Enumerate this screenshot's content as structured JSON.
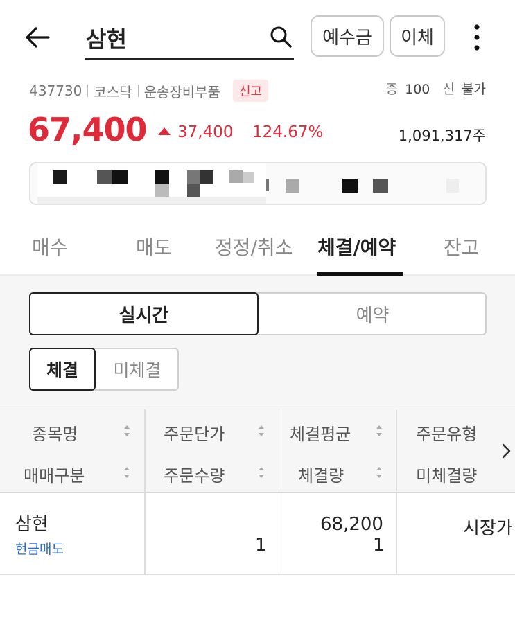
{
  "header": {
    "search_value": "삼현",
    "deposit_label": "예수금",
    "transfer_label": "이체"
  },
  "stock": {
    "code": "437730",
    "market": "코스닥",
    "sector": "운송장비부품",
    "badge": "신고",
    "margin_label": "증",
    "margin_value": "100",
    "credit_label": "신",
    "credit_value": "불가",
    "price": "67,400",
    "change": "37,400",
    "change_pct": "124.67%",
    "volume": "1,091,317주",
    "up_color": "#e02a3a"
  },
  "tabs": [
    "매수",
    "매도",
    "정정/취소",
    "체결/예약",
    "잔고"
  ],
  "active_tab": "체결/예약",
  "segment": {
    "left": "실시간",
    "right": "예약",
    "selected": "실시간"
  },
  "subsegment": {
    "left": "체결",
    "right": "미체결",
    "selected": "체결"
  },
  "table": {
    "headers_row1": [
      "종목명",
      "주문단가",
      "체결평균",
      "주문유형"
    ],
    "headers_row2": [
      "매매구분",
      "주문수량",
      "체결량",
      "미체결량"
    ],
    "rows": [
      {
        "name": "삼현",
        "trade_type": "현금매도",
        "order_price": "",
        "order_qty": "1",
        "avg_fill": "68,200",
        "fill_qty": "1",
        "order_type": "시장가",
        "unfilled_qty": ""
      }
    ]
  }
}
